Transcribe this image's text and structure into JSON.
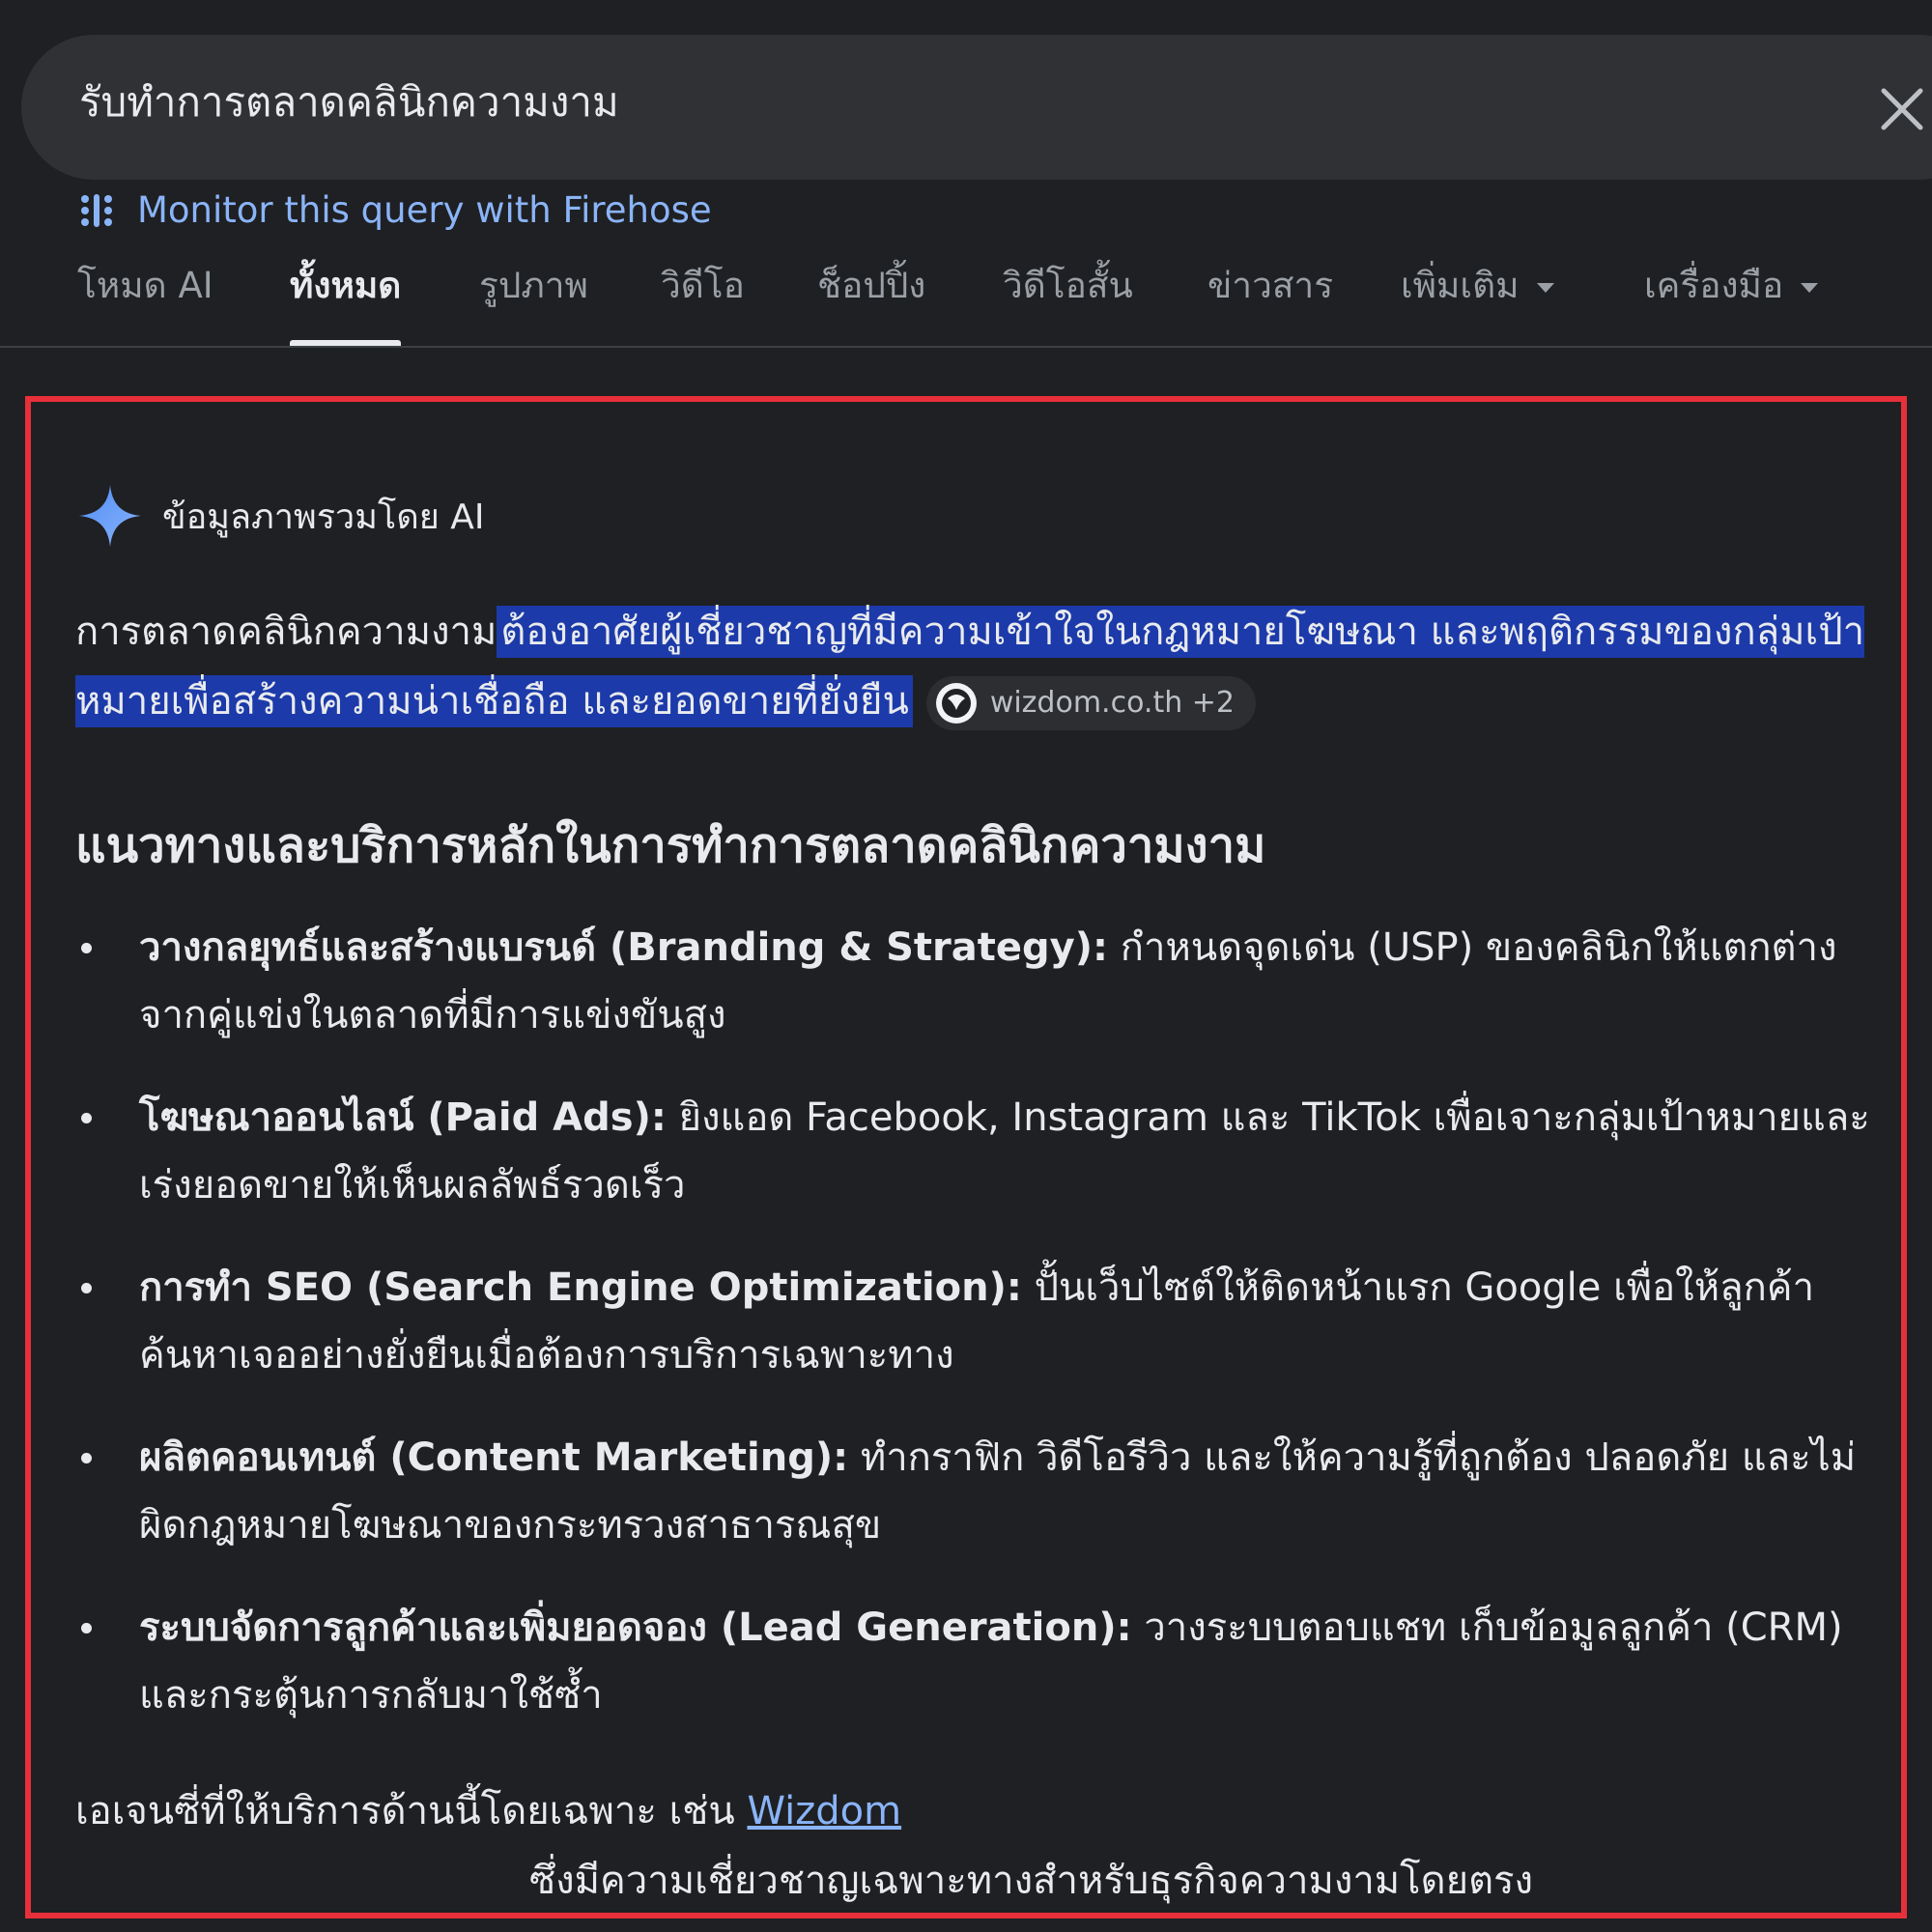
{
  "search": {
    "query": "รับทำการตลาดคลินิกความงาม",
    "clear_icon": "close-icon"
  },
  "firehose": {
    "label": "Monitor this query with Firehose",
    "icon": "firehose-icon"
  },
  "tabs": [
    {
      "label": "โหมด AI",
      "active": false
    },
    {
      "label": "ทั้งหมด",
      "active": true
    },
    {
      "label": "รูปภาพ",
      "active": false
    },
    {
      "label": "วิดีโอ",
      "active": false
    },
    {
      "label": "ช็อปปิ้ง",
      "active": false
    },
    {
      "label": "วิดีโอสั้น",
      "active": false
    },
    {
      "label": "ข่าวสาร",
      "active": false
    },
    {
      "label": "เพิ่มเติม",
      "active": false,
      "dropdown": true
    },
    {
      "label": "เครื่องมือ",
      "active": false,
      "dropdown": true
    }
  ],
  "ai_overview": {
    "header": "ข้อมูลภาพรวมโดย AI",
    "header_icon": "sparkle-icon",
    "intro_plain": "การตลาดคลินิกความงาม",
    "intro_highlight": "ต้องอาศัยผู้เชี่ยวชาญที่มีความเข้าใจในกฎหมายโฆษณา และพฤติกรรมของกลุ่มเป้าหมายเพื่อสร้างความน่าเชื่อถือ และยอดขายที่ยั่งยืน",
    "source_chip": "wizdom.co.th +2",
    "heading": "แนวทางและบริการหลักในการทำการตลาดคลินิกความงาม",
    "bullets": [
      {
        "title": "วางกลยุทธ์และสร้างแบรนด์ (Branding & Strategy):",
        "text": " กำหนดจุดเด่น (USP) ของคลินิกให้แตกต่างจากคู่แข่งในตลาดที่มีการแข่งขันสูง"
      },
      {
        "title": "โฆษณาออนไลน์ (Paid Ads):",
        "text": " ยิงแอด Facebook, Instagram และ TikTok เพื่อเจาะกลุ่มเป้าหมายและเร่งยอดขายให้เห็นผลลัพธ์รวดเร็ว"
      },
      {
        "title": "การทำ SEO (Search Engine Optimization):",
        "text": " ปั้นเว็บไซต์ให้ติดหน้าแรก Google เพื่อให้ลูกค้าค้นหาเจออย่างยั่งยืนเมื่อต้องการบริการเฉพาะทาง"
      },
      {
        "title": "ผลิตคอนเทนต์ (Content Marketing):",
        "text": " ทำกราฟิก วิดีโอรีวิว และให้ความรู้ที่ถูกต้อง ปลอดภัย และไม่ผิดกฎหมายโฆษณาของกระทรวงสาธารณสุข"
      },
      {
        "title": "ระบบจัดการลูกค้าและเพิ่มยอดจอง (Lead Generation):",
        "text": " วางระบบตอบแชท เก็บข้อมูลลูกค้า (CRM) และกระตุ้นการกลับมาใช้ซ้ำ"
      }
    ],
    "agency_prefix": "เอเจนซี่ที่ให้บริการด้านนี้โดยเฉพาะ เช่น ",
    "agency_link": "Wizdom",
    "agency_suffix": "ซึ่งมีความเชี่ยวชาญเฉพาะทางสำหรับธุรกิจความงามโดยตรง"
  },
  "colors": {
    "background": "#1f2023",
    "search_bar": "#303134",
    "link": "#8ab4f8",
    "highlight": "#1c3aa9",
    "frame": "#e8303a"
  }
}
